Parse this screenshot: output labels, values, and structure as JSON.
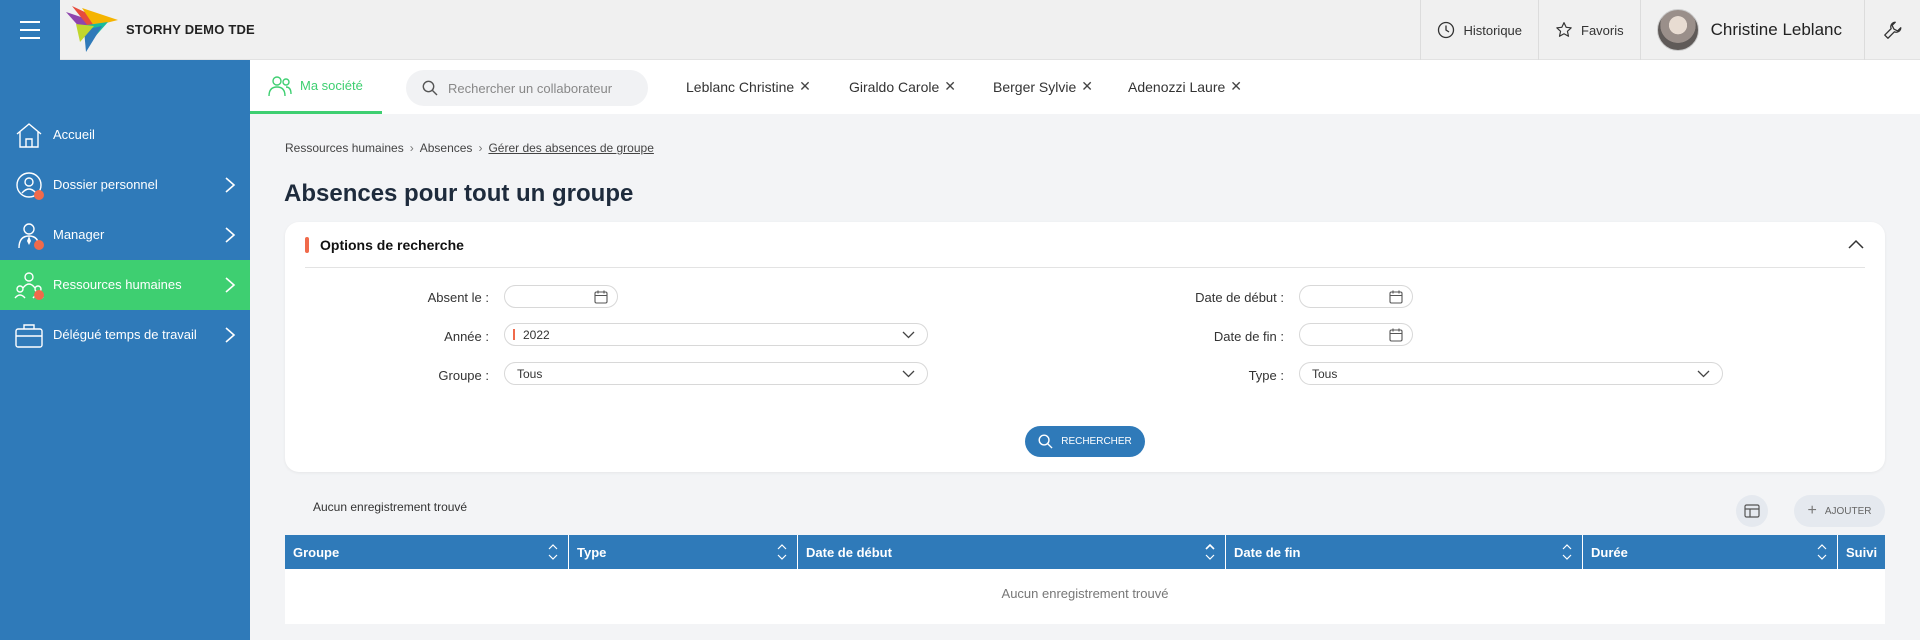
{
  "header": {
    "brand": "STORHY DEMO TDE",
    "historique": "Historique",
    "favoris": "Favoris",
    "user_name": "Christine Leblanc"
  },
  "sidebar": {
    "items": [
      {
        "label": "Accueil",
        "icon": "home-icon",
        "badge": false,
        "chevron": false,
        "active": false
      },
      {
        "label": "Dossier personnel",
        "icon": "user-icon",
        "badge": true,
        "chevron": true,
        "active": false
      },
      {
        "label": "Manager",
        "icon": "manager-icon",
        "badge": true,
        "chevron": true,
        "active": false
      },
      {
        "label": "Ressources humaines",
        "icon": "hr-icon",
        "badge": true,
        "chevron": true,
        "active": true
      },
      {
        "label": "Délégué temps de travail",
        "icon": "briefcase-icon",
        "badge": false,
        "chevron": true,
        "active": false
      }
    ]
  },
  "subbar": {
    "tab_label": "Ma société",
    "search_placeholder": "Rechercher un collaborateur",
    "chips": [
      "Leblanc Christine",
      "Giraldo Carole",
      "Berger Sylvie",
      "Adenozzi Laure"
    ]
  },
  "breadcrumb": [
    "Ressources humaines",
    "Absences",
    "Gérer des absences de groupe"
  ],
  "page_title": "Absences pour tout un groupe",
  "search_options": {
    "title": "Options de recherche",
    "absent_label": "Absent le :",
    "absent_value": "",
    "annee_label": "Année :",
    "annee_value": "2022",
    "groupe_label": "Groupe :",
    "groupe_value": "Tous",
    "date_debut_label": "Date de début :",
    "date_debut_value": "",
    "date_fin_label": "Date de fin :",
    "date_fin_value": "",
    "type_label": "Type :",
    "type_value": "Tous",
    "search_button": "RECHERCHER"
  },
  "results": {
    "no_records": "Aucun enregistrement trouvé",
    "add_button": "AJOUTER",
    "columns": [
      "Groupe",
      "Type",
      "Date de début",
      "Date de fin",
      "Durée",
      "Suivi"
    ],
    "empty_text": "Aucun enregistrement trouvé"
  },
  "colors": {
    "primary": "#2f7ab9",
    "accent_green": "#3ecf71",
    "badge_orange": "#f06a4b"
  }
}
